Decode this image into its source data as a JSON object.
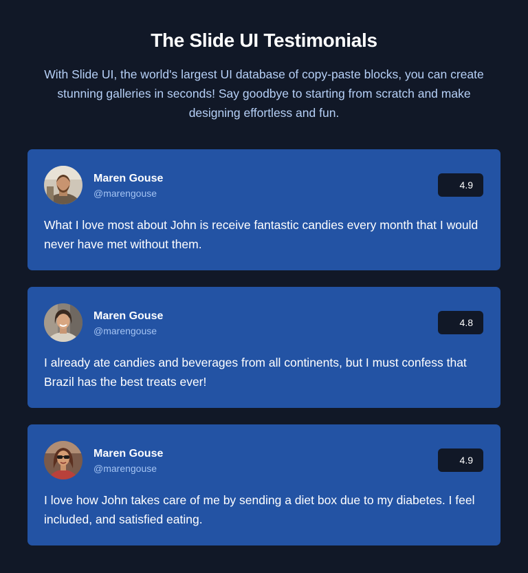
{
  "header": {
    "title": "The Slide UI Testimonials",
    "subtitle": "With Slide UI, the world's largest UI database of copy-paste blocks, you can create stunning galleries in seconds! Say goodbye to starting from scratch and make designing effortless and fun."
  },
  "colors": {
    "background": "#111827",
    "card": "#2353a4",
    "rating_badge": "#111827",
    "handle_text": "#a5c4f3"
  },
  "testimonials": [
    {
      "name": "Maren Gouse",
      "handle": "@marengouse",
      "rating": "4.9",
      "quote": "What I love most about John is receive fantastic candies every month that I would never have met without them.",
      "avatar_icon": "man-with-beard-avatar"
    },
    {
      "name": "Maren Gouse",
      "handle": "@marengouse",
      "rating": "4.8",
      "quote": "I already ate candies and beverages from all continents, but I must confess that Brazil has the best treats ever!",
      "avatar_icon": "smiling-woman-avatar"
    },
    {
      "name": "Maren Gouse",
      "handle": "@marengouse",
      "rating": "4.9",
      "quote": "I love how John takes care of me by sending a diet box due to my diabetes. I feel included, and satisfied eating.",
      "avatar_icon": "woman-with-sunglasses-avatar"
    }
  ]
}
